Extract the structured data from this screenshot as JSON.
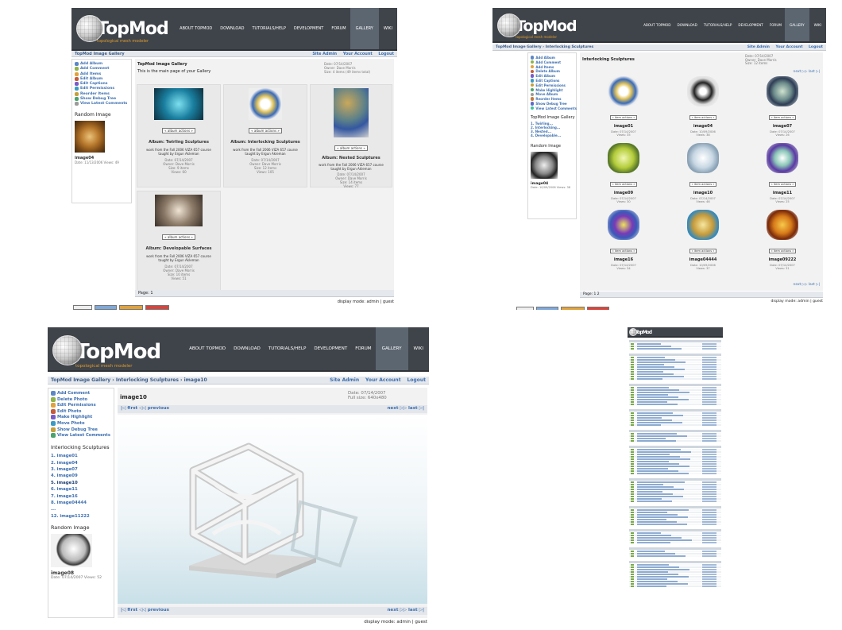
{
  "site": {
    "logo_text": "TopMod",
    "logo_sub": "topological mesh modeler",
    "nav": [
      "ABOUT TOPMOD",
      "DOWNLOAD",
      "TUTORIALS/HELP",
      "DEVELOPMENT",
      "FORUM",
      "GALLERY",
      "WIKI"
    ],
    "active_nav": "GALLERY",
    "util_links": [
      "Site Admin",
      "Your Account",
      "Logout"
    ],
    "display_mode": "display mode: admin | guest"
  },
  "panel1": {
    "crumb": "TopMod Image Gallery",
    "sidebar_links": [
      "Add Album",
      "Add Comment",
      "Add Items",
      "Edit Album",
      "Edit Captions",
      "Edit Permissions",
      "Reorder Items",
      "Show Debug Tree",
      "View Latest Comments"
    ],
    "random_heading": "Random Image",
    "random_title": "image04",
    "random_meta": "Date: 11/13/2006 Views: 49",
    "title": "TopMod Image Gallery",
    "subtitle": "This is the main page of your Gallery",
    "meta": [
      "Date: 07/14/2007",
      "Owner: Dave Morris",
      "Size: 4 items (49 items total)"
    ],
    "albums": [
      {
        "title": "Album: Twirling Sculptures",
        "desc": "work from the Fall 2006 VIZA 657 course taught by Ergun Akleman",
        "meta": [
          "Date: 07/14/2007",
          "Owner: Dave Morris",
          "Size: 9 items",
          "Views: 60"
        ],
        "action": "« album actions »"
      },
      {
        "title": "Album: Interlocking Sculptures",
        "desc": "work from the Fall 2006 VIZA 657 course taught by Ergun Akleman",
        "meta": [
          "Date: 07/14/2007",
          "Owner: Dave Morris",
          "Size: 12 items",
          "Views: 105"
        ],
        "action": "« album actions »"
      },
      {
        "title": "Album: Nested Sculptures",
        "desc": "work from the Fall 2006 VIZA 657 course taught by Ergun Akleman",
        "meta": [
          "Date: 07/14/2007",
          "Owner: Dave Morris",
          "Size: 14 items",
          "Views: 77"
        ],
        "action": "« album actions »"
      },
      {
        "title": "Album: Developable Surfaces",
        "desc": "work from the Fall 2006 VIZA 657 course taught by Ergun Akleman",
        "meta": [
          "Date: 07/14/2007",
          "Owner: Dave Morris",
          "Size: 10 items",
          "Views: 51"
        ],
        "action": "« album actions »"
      }
    ],
    "page": "Page: 1"
  },
  "panel2": {
    "crumb": "TopMod Image Gallery › Interlocking Sculptures",
    "sidebar_links": [
      "Add Album",
      "Add Comment",
      "Add Items",
      "Delete Album",
      "Edit Album",
      "Edit Captions",
      "Edit Permissions",
      "Make Highlight",
      "Move Album",
      "Reorder Items",
      "Show Debug Tree",
      "View Latest Comments"
    ],
    "gallery_heading": "TopMod Image Gallery",
    "gallery_items": [
      "1. Twirling...",
      "2. Interlocking...",
      "3. Nested...",
      "4. Developable..."
    ],
    "random_heading": "Random Image",
    "random_title": "image04",
    "random_meta": "Date: 10/09/2006 Views: 38",
    "title": "Interlocking Sculptures",
    "meta": [
      "Date: 07/14/2007",
      "Owner: Dave Morris",
      "Size: 12 items"
    ],
    "next_last": "next ▷▷ last ▷|",
    "items": [
      {
        "name": "image01",
        "date": "Date: 07/14/2007",
        "views": "Views: 35"
      },
      {
        "name": "image04",
        "date": "Date: 10/09/2006",
        "views": "Views: 38"
      },
      {
        "name": "image07",
        "date": "Date: 07/14/2007",
        "views": "Views: 26"
      },
      {
        "name": "image09",
        "date": "Date: 07/14/2007",
        "views": "Views: 30"
      },
      {
        "name": "image10",
        "date": "Date: 07/14/2007",
        "views": "Views: 46"
      },
      {
        "name": "image11",
        "date": "Date: 07/14/2007",
        "views": "Views: 25"
      },
      {
        "name": "image16",
        "date": "Date: 07/14/2007",
        "views": "Views: 34"
      },
      {
        "name": "image04444",
        "date": "Date: 10/09/2006",
        "views": "Views: 37"
      },
      {
        "name": "image09222",
        "date": "Date: 07/14/2007",
        "views": "Views: 31"
      }
    ],
    "item_action": "« item actions »",
    "page": "Page: 1 2"
  },
  "panel3": {
    "crumb": "TopMod Image Gallery › Interlocking Sculptures › image10",
    "sidebar_links": [
      "Add Comment",
      "Delete Photo",
      "Edit Permissions",
      "Edit Photo",
      "Make Highlight",
      "Move Photo",
      "Show Debug Tree",
      "View Latest Comments"
    ],
    "list_heading": "Interlocking Sculptures",
    "list_items": [
      "1. image01",
      "2. image04",
      "3. image07",
      "4. image09",
      "5. image10",
      "6. image11",
      "7. image16",
      "8. image04444",
      "...",
      "12. image11222"
    ],
    "active_index": 4,
    "random_heading": "Random Image",
    "random_title": "image08",
    "random_meta": "Date: 07/14/2007 Views: 52",
    "title": "image10",
    "meta": [
      "Date: 07/14/2007",
      "Full size: 640x480"
    ],
    "prev": "|◁ first ◁◁ previous",
    "next": "next ▷▷ last ▷|"
  },
  "panel4": {
    "logo_text": "TopMod"
  },
  "colors": {
    "header": "#3f444a",
    "accent_orange": "#e19b2b",
    "link_blue": "#3d6fb0",
    "active_nav": "#5c6671"
  }
}
